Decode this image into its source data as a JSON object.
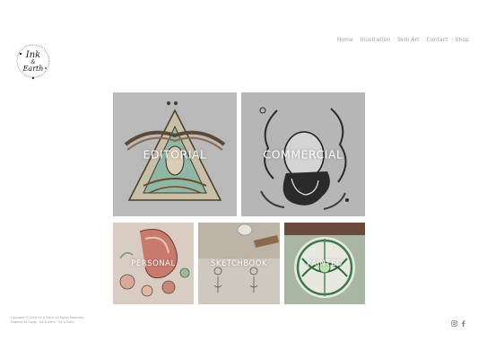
{
  "logo": {
    "text_top": "Ink",
    "text_amp": "&",
    "text_bottom": "Earth"
  },
  "nav": {
    "items": [
      {
        "label": "Home"
      },
      {
        "label": "Illustration"
      },
      {
        "label": "Skin Art"
      },
      {
        "label": "Contact"
      },
      {
        "label": "Shop"
      }
    ]
  },
  "gallery": {
    "tiles": [
      {
        "label": "EDITORIAL"
      },
      {
        "label": "COMMERCIAL"
      },
      {
        "label": "PERSONAL"
      },
      {
        "label": "SKETCHBOOK"
      },
      {
        "label": "PAINTED"
      }
    ]
  },
  "footer": {
    "line1": "Copyright © 2018 Ink & Earth. All Rights Reserved.",
    "line2": "Powered by Cargo · Ink & Earth · Ink & Earth"
  },
  "social": {
    "icons": [
      "instagram-icon",
      "facebook-icon"
    ]
  }
}
